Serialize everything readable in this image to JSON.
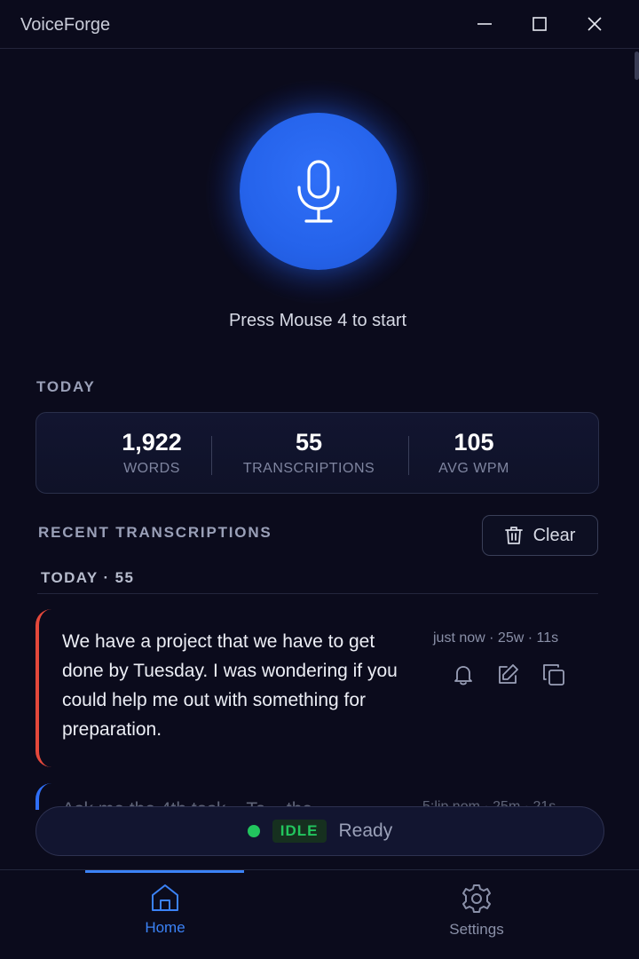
{
  "window": {
    "title": "VoiceForge",
    "controls": [
      "minimize-icon",
      "maximize-icon",
      "close-icon"
    ]
  },
  "mic": {
    "icon": "microphone-icon",
    "hint": "Press Mouse 4 to start"
  },
  "today": {
    "label": "TODAY",
    "stats": [
      {
        "value": "1,922",
        "label": "WORDS"
      },
      {
        "value": "55",
        "label": "TRANSCRIPTIONS"
      },
      {
        "value": "105",
        "label": "AVG WPM"
      }
    ]
  },
  "recent": {
    "label": "RECENT TRANSCRIPTIONS",
    "clear_label": "Clear",
    "clear_icon": "trash-icon",
    "group_label": "TODAY · 55",
    "items": [
      {
        "text": "We have a project that we have to get done by Tuesday. I was wondering if you could help me out with something for preparation.",
        "meta": "just now · 25w · 11s",
        "accent_color": "#e5483b",
        "actions": [
          "bell-icon",
          "edit-icon",
          "copy-icon"
        ]
      },
      {
        "text": "Ask me the 4th task... Ta... the",
        "meta": "5:lip nom · 25m · 21s",
        "accent_color": "#2f6ff7"
      }
    ]
  },
  "status": {
    "badge": "IDLE",
    "text": "Ready",
    "color": "#22c55e"
  },
  "nav": {
    "items": [
      {
        "label": "Home",
        "icon": "home-icon",
        "active": true
      },
      {
        "label": "Settings",
        "icon": "gear-icon",
        "active": false
      }
    ]
  },
  "colors": {
    "background": "#0b0b1c",
    "accent": "#2563eb",
    "active_nav": "#3b82f6"
  }
}
